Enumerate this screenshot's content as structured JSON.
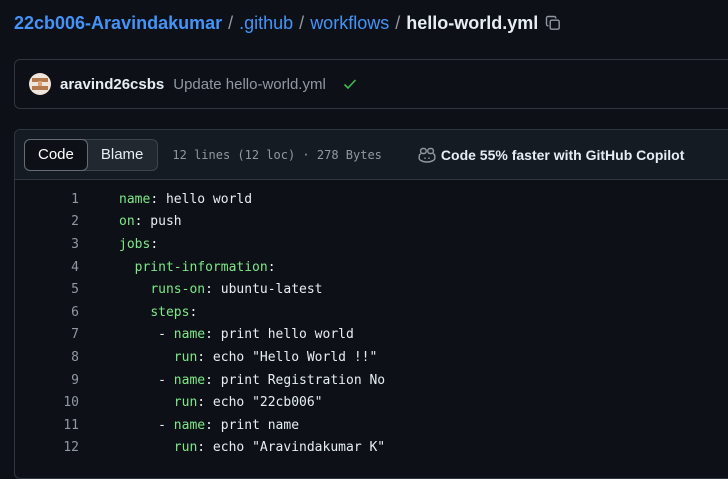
{
  "breadcrumb": {
    "repo": "22cb006-Aravindakumar",
    "sep": "/",
    "dir1": ".github",
    "dir2": "workflows",
    "file": "hello-world.yml"
  },
  "commit": {
    "author": "aravind26csbs",
    "message": "Update hello-world.yml"
  },
  "file_header": {
    "tab_code": "Code",
    "tab_blame": "Blame",
    "info": "12 lines (12 loc) · 278 Bytes",
    "copilot": "Code 55% faster with GitHub Copilot"
  },
  "code": [
    {
      "n": "1",
      "indent": "",
      "key": "name",
      "colon": ":",
      "val": " hello world"
    },
    {
      "n": "2",
      "indent": "",
      "key": "on",
      "colon": ":",
      "val": " push"
    },
    {
      "n": "3",
      "indent": "",
      "key": "jobs",
      "colon": ":",
      "val": ""
    },
    {
      "n": "4",
      "indent": "  ",
      "key": "print-information",
      "colon": ":",
      "val": ""
    },
    {
      "n": "5",
      "indent": "    ",
      "key": "runs-on",
      "colon": ":",
      "val": " ubuntu-latest"
    },
    {
      "n": "6",
      "indent": "    ",
      "key": "steps",
      "colon": ":",
      "val": ""
    },
    {
      "n": "7",
      "indent": "     - ",
      "key": "name",
      "colon": ":",
      "val": " print hello world"
    },
    {
      "n": "8",
      "indent": "       ",
      "key": "run",
      "colon": ":",
      "val": " echo \"Hello World !!\""
    },
    {
      "n": "9",
      "indent": "     - ",
      "key": "name",
      "colon": ":",
      "val": " print Registration No"
    },
    {
      "n": "10",
      "indent": "       ",
      "key": "run",
      "colon": ":",
      "val": " echo \"22cb006\""
    },
    {
      "n": "11",
      "indent": "     - ",
      "key": "name",
      "colon": ":",
      "val": " print name"
    },
    {
      "n": "12",
      "indent": "       ",
      "key": "run",
      "colon": ":",
      "val": " echo \"Aravindakumar K\""
    }
  ],
  "colors": {
    "background": "#0d1117",
    "link": "#4493f8",
    "yaml_key": "#7ee787",
    "yaml_value": "#a5d6ff",
    "success": "#3fb950"
  },
  "icons": [
    "copy-icon",
    "check-icon",
    "copilot-icon"
  ]
}
